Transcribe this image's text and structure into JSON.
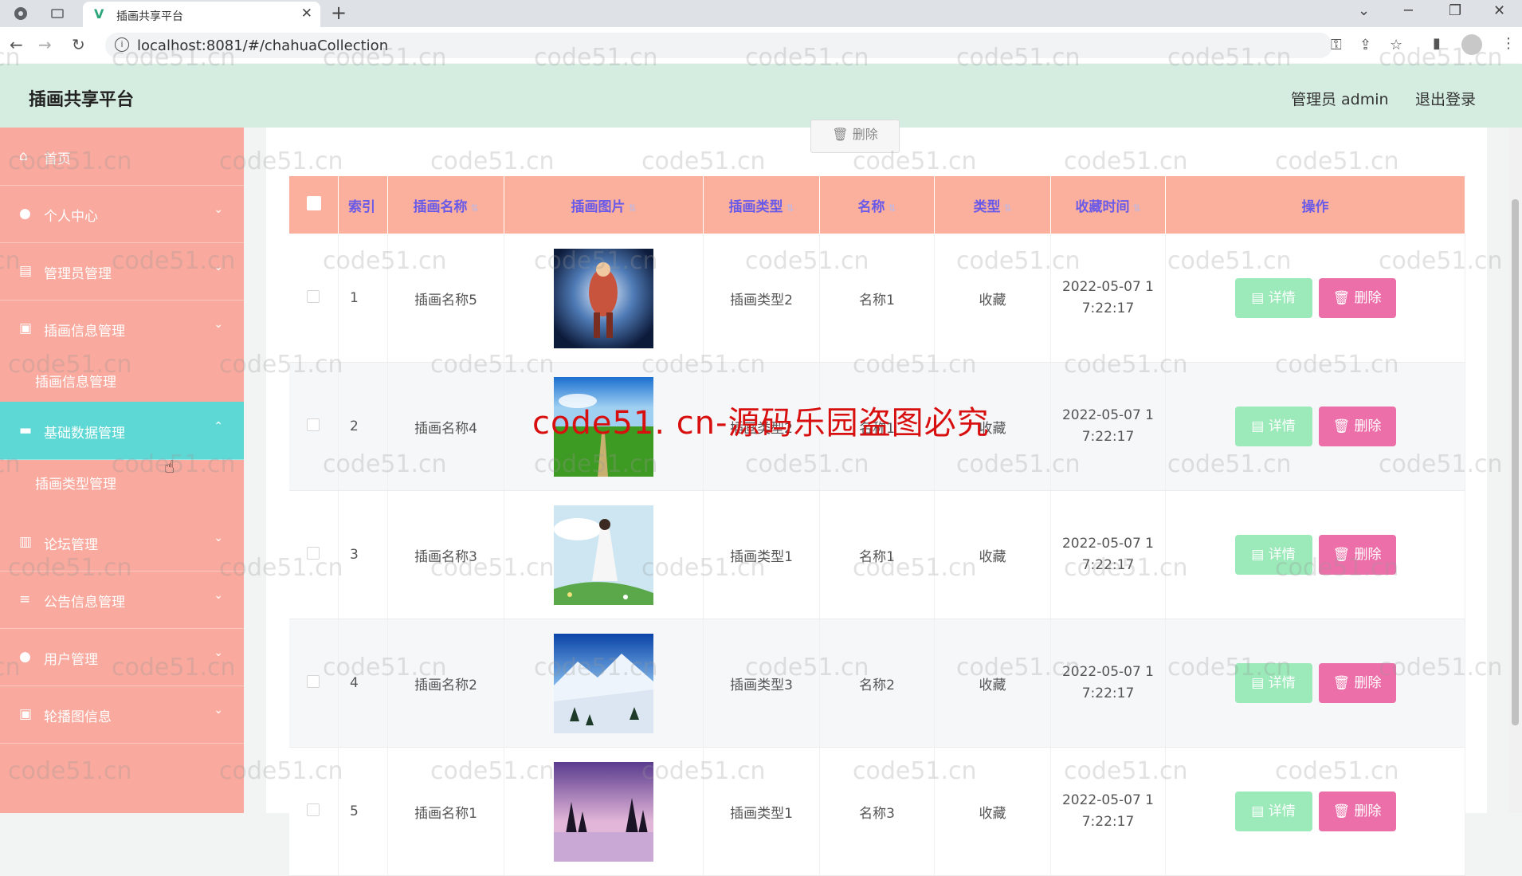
{
  "browser": {
    "tab_title": "插画共享平台",
    "tab_favicon": "V",
    "url": "localhost:8081/#/chahuaCollection"
  },
  "header": {
    "title": "插画共享平台",
    "user": "管理员 admin",
    "logout": "退出登录"
  },
  "sidebar": {
    "items": [
      {
        "label": "首页",
        "icon": "home-icon"
      },
      {
        "label": "个人中心",
        "icon": "user-icon"
      },
      {
        "label": "管理员管理",
        "icon": "stack-icon"
      },
      {
        "label": "插画信息管理",
        "icon": "clipboard-icon"
      },
      {
        "label": "插画信息管理",
        "icon": ""
      },
      {
        "label": "基础数据管理",
        "icon": "database-icon"
      },
      {
        "label": "插画类型管理",
        "icon": ""
      },
      {
        "label": "论坛管理",
        "icon": "chart-icon"
      },
      {
        "label": "公告信息管理",
        "icon": "list-icon"
      },
      {
        "label": "用户管理",
        "icon": "user-icon"
      },
      {
        "label": "轮播图信息",
        "icon": "clipboard-icon"
      }
    ]
  },
  "toolbar": {
    "delete_label": "删除"
  },
  "table": {
    "headers": [
      "",
      "索引",
      "插画名称",
      "插画图片",
      "插画类型",
      "名称",
      "类型",
      "收藏时间",
      "操作"
    ],
    "rows": [
      {
        "index": "1",
        "name": "插画名称5",
        "image": "fantasy",
        "type": "插画类型2",
        "title": "名称1",
        "kind": "收藏",
        "time1": "2022-05-07 1",
        "time2": "7:22:17"
      },
      {
        "index": "2",
        "name": "插画名称4",
        "image": "meadow",
        "type": "插画类型2",
        "title": "名称1",
        "kind": "收藏",
        "time1": "2022-05-07 1",
        "time2": "7:22:17"
      },
      {
        "index": "3",
        "name": "插画名称3",
        "image": "girl",
        "type": "插画类型1",
        "title": "名称1",
        "kind": "收藏",
        "time1": "2022-05-07 1",
        "time2": "7:22:17"
      },
      {
        "index": "4",
        "name": "插画名称2",
        "image": "snow",
        "type": "插画类型3",
        "title": "名称2",
        "kind": "收藏",
        "time1": "2022-05-07 1",
        "time2": "7:22:17"
      },
      {
        "index": "5",
        "name": "插画名称1",
        "image": "lake",
        "type": "插画类型1",
        "title": "名称3",
        "kind": "收藏",
        "time1": "2022-05-07 1",
        "time2": "7:22:17"
      }
    ],
    "detail_label": "详情",
    "delete_label": "删除"
  },
  "watermark": {
    "text": "code51.cn",
    "big_text": "code51. cn-源码乐园盗图必究"
  },
  "colors": {
    "header_bg": "#d5ede1",
    "sidebar_bg": "#f9a99d",
    "sidebar_active": "#5ed8d4",
    "table_head": "#fbaf9d",
    "head_text": "#6a5ae8",
    "detail_btn": "#9ce9ba",
    "delete_btn": "#ec6fa9"
  }
}
